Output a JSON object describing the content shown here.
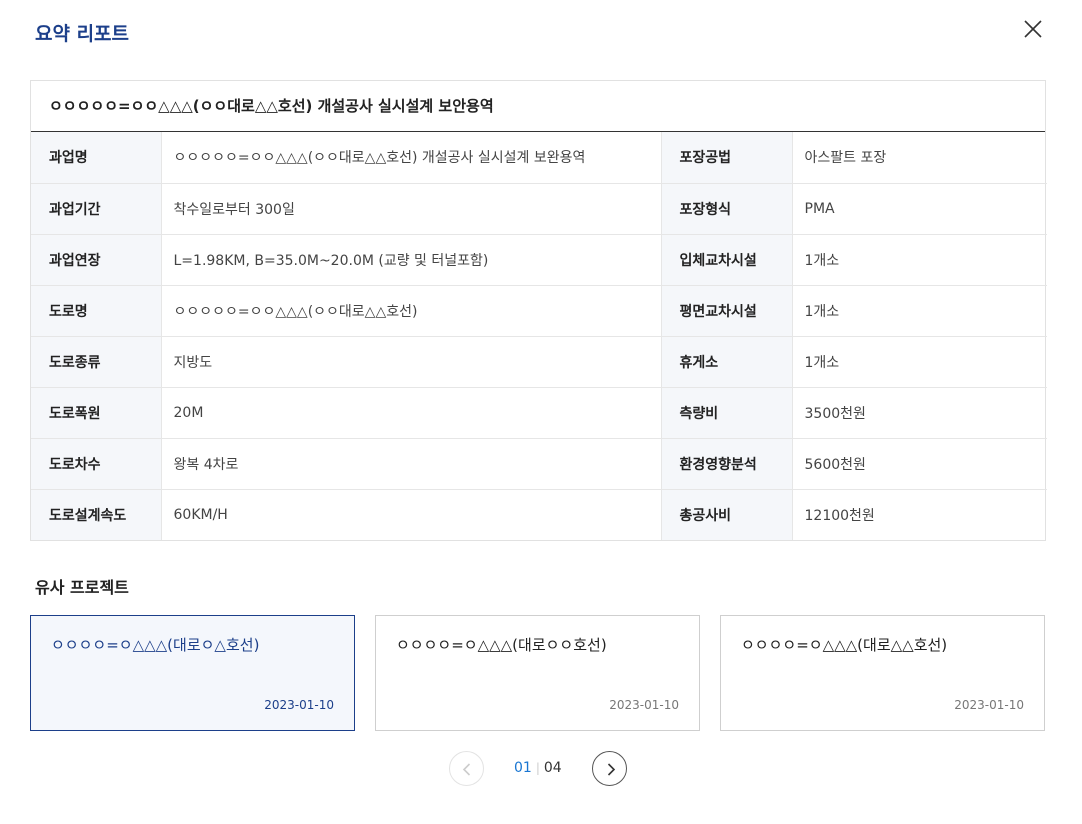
{
  "modal": {
    "title": "요약 리포트",
    "close_icon": "close-icon"
  },
  "report": {
    "title": "ㅇㅇㅇㅇㅇ=ㅇㅇ△△△(ㅇㅇ대로△△호선) 개설공사 실시설계 보안용역",
    "rows": [
      {
        "l1": "과업명",
        "v1": "ㅇㅇㅇㅇㅇ=ㅇㅇ△△△(ㅇㅇ대로△△호선) 개설공사 실시설계 보완용역",
        "l2": "포장공법",
        "v2": "아스팔트 포장"
      },
      {
        "l1": "과업기간",
        "v1": "착수일로부터 300일",
        "l2": "포장형식",
        "v2": "PMA"
      },
      {
        "l1": "과업연장",
        "v1": "L=1.98KM, B=35.0M~20.0M (교량 및 터널포함)",
        "l2": "입체교차시설",
        "v2": "1개소"
      },
      {
        "l1": "도로명",
        "v1": "ㅇㅇㅇㅇㅇ=ㅇㅇ△△△(ㅇㅇ대로△△호선)",
        "l2": "평면교차시설",
        "v2": "1개소"
      },
      {
        "l1": "도로종류",
        "v1": "지방도",
        "l2": "휴게소",
        "v2": "1개소"
      },
      {
        "l1": "도로폭원",
        "v1": "20M",
        "l2": "측량비",
        "v2": "3500천원"
      },
      {
        "l1": "도로차수",
        "v1": "왕복 4차로",
        "l2": "환경영향분석",
        "v2": "5600천원"
      },
      {
        "l1": "도로설계속도",
        "v1": "60KM/H",
        "l2": "총공사비",
        "v2": "12100천원"
      }
    ]
  },
  "similar": {
    "title": "유사 프로젝트",
    "cards": [
      {
        "name": "ㅇㅇㅇㅇ=ㅇ△△△(대로ㅇ△호선)",
        "date": "2023-01-10"
      },
      {
        "name": "ㅇㅇㅇㅇ=ㅇ△△△(대로ㅇㅇ호선)",
        "date": "2023-01-10"
      },
      {
        "name": "ㅇㅇㅇㅇ=ㅇ△△△(대로△△호선)",
        "date": "2023-01-10"
      }
    ]
  },
  "pagination": {
    "current": "01",
    "separator": "|",
    "total": "04",
    "prev_icon": "chevron-left-icon",
    "next_icon": "chevron-right-icon"
  },
  "colors": {
    "accent": "#1c3f8a",
    "page_current": "#1976d2",
    "label_bg": "#f5f7fa"
  }
}
